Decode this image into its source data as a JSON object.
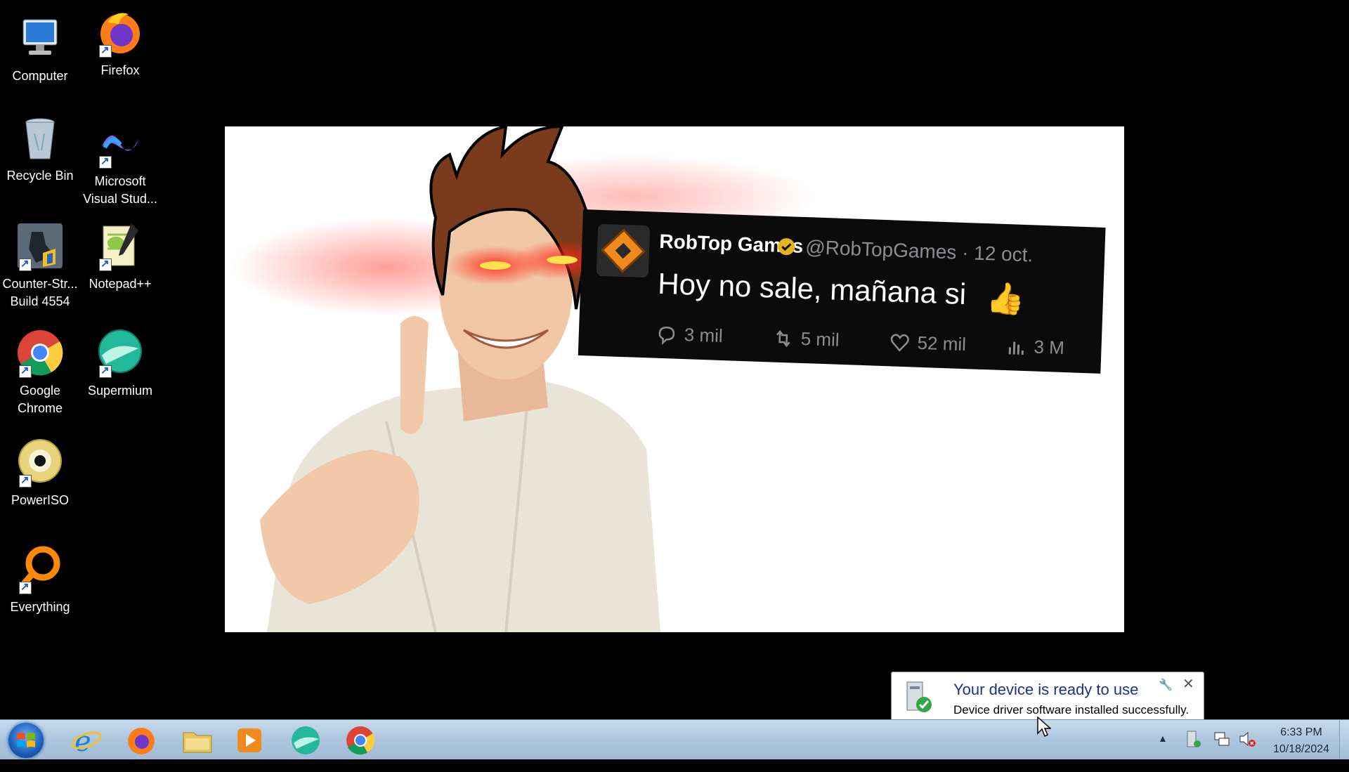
{
  "desktop": {
    "icons": [
      {
        "label": "Computer"
      },
      {
        "label": "Firefox"
      },
      {
        "label": "Recycle Bin"
      },
      {
        "label_line1": "Microsoft",
        "label_line2": "Visual Stud..."
      },
      {
        "label_line1": "Counter-Str...",
        "label_line2": "Build 4554"
      },
      {
        "label": "Notepad++"
      },
      {
        "label_line1": "Google",
        "label_line2": "Chrome"
      },
      {
        "label": "Supermium"
      },
      {
        "label": "PowerISO"
      },
      {
        "label": "Everything"
      }
    ]
  },
  "tweet": {
    "name": "RobTop Games",
    "handle": "@RobTopGames · 12 oct.",
    "text": "Hoy no sale, mañana si",
    "thumb": "👍",
    "replies": "3 mil",
    "retweets": "5 mil",
    "likes": "52 mil",
    "views": "3 M"
  },
  "notification": {
    "title": "Your device is ready to use",
    "body": "Device driver software installed successfully.",
    "close": "✕",
    "tool": "🔧"
  },
  "taskbar": {
    "apps": [
      "start-button",
      "internet-explorer-icon",
      "firefox-icon",
      "file-explorer-icon",
      "media-player-icon",
      "supermium-icon",
      "chrome-icon"
    ],
    "tray_arrow": "▲",
    "time": "6:33 PM",
    "date": "10/18/2024"
  },
  "colors": {
    "taskbar": "#aec6df",
    "balloon_title": "#1e3287",
    "tweet_bg": "#0b0b0b"
  }
}
